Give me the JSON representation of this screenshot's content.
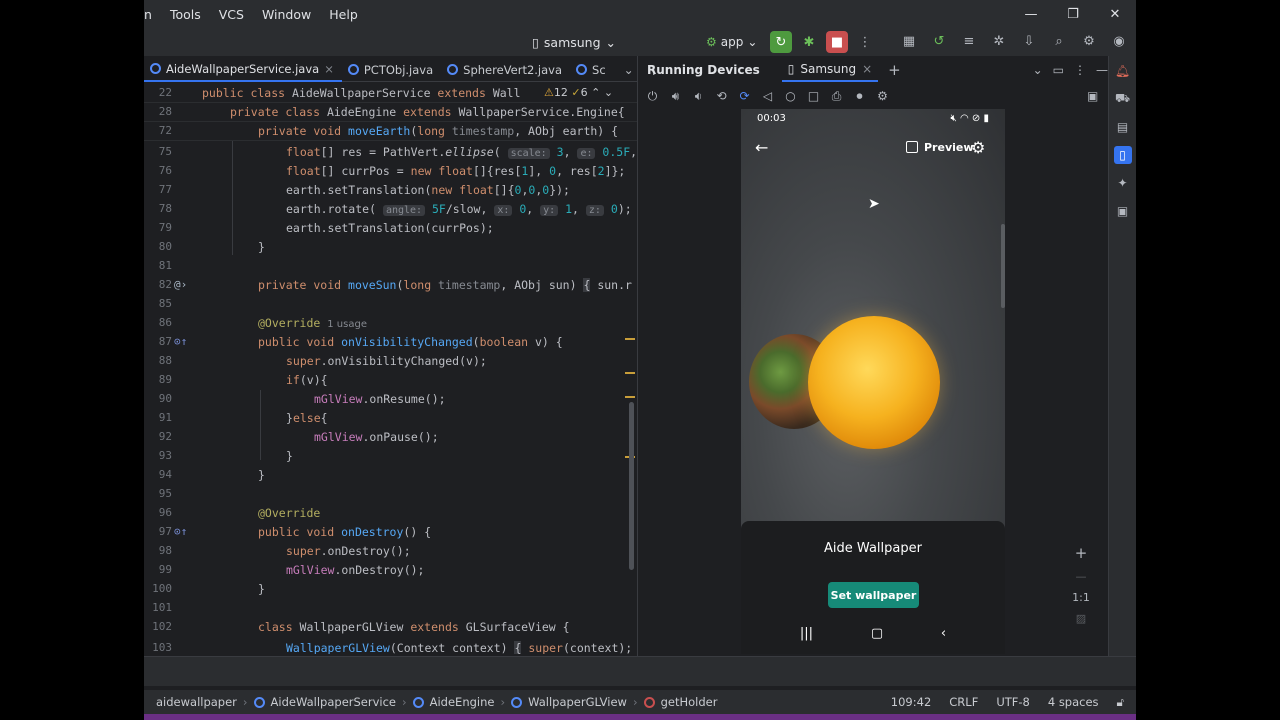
{
  "menu": [
    "n",
    "Tools",
    "VCS",
    "Window",
    "Help"
  ],
  "window_controls": [
    "—",
    "❐",
    "✕"
  ],
  "toolbar": {
    "device": "samsung",
    "config": "app",
    "icons": [
      "run-refresh",
      "debug",
      "stop",
      "more"
    ]
  },
  "editor_tabs": [
    {
      "label": "AideWallpaperService.java",
      "active": true
    },
    {
      "label": "PCTObj.java",
      "active": false
    },
    {
      "label": "SphereVert2.java",
      "active": false
    },
    {
      "label": "Sc",
      "active": false
    }
  ],
  "inspection": {
    "warnings": "12",
    "weak": "6"
  },
  "code_lines": [
    {
      "n": "22"
    },
    {
      "n": "28"
    },
    {
      "n": "72"
    },
    {
      "n": "75"
    },
    {
      "n": "76"
    },
    {
      "n": "77"
    },
    {
      "n": "78"
    },
    {
      "n": "79"
    },
    {
      "n": "80"
    },
    {
      "n": "81"
    },
    {
      "n": "82"
    },
    {
      "n": "85"
    },
    {
      "n": "86"
    },
    {
      "n": "87"
    },
    {
      "n": "88"
    },
    {
      "n": "89"
    },
    {
      "n": "90"
    },
    {
      "n": "91"
    },
    {
      "n": "92"
    },
    {
      "n": "93"
    },
    {
      "n": "94"
    },
    {
      "n": "95"
    },
    {
      "n": "96"
    },
    {
      "n": "97"
    },
    {
      "n": "98"
    },
    {
      "n": "99"
    },
    {
      "n": "100"
    },
    {
      "n": "101"
    },
    {
      "n": "102"
    },
    {
      "n": "103"
    }
  ],
  "code": {
    "usage_hint": "1 usage",
    "hint_scale": "scale:",
    "hint_e": "e:",
    "hint_angle": "angle:",
    "hint_x": "x:",
    "hint_y": "y:",
    "hint_z": "z:"
  },
  "running_devices": {
    "title": "Running Devices",
    "device_tab": "Samsung"
  },
  "phone": {
    "time": "00:03",
    "preview_label": "Preview",
    "wallpaper_name": "Aide Wallpaper",
    "set_button": "Set wallpaper"
  },
  "zoom": {
    "ratio": "1:1"
  },
  "breadcrumbs": [
    "aidewallpaper",
    "AideWallpaperService",
    "AideEngine",
    "WallpaperGLView",
    "getHolder"
  ],
  "status": {
    "position": "109:42",
    "line_sep": "CRLF",
    "encoding": "UTF-8",
    "indent": "4 spaces"
  },
  "colors": {
    "accent": "#3574f0",
    "run_green": "#4e9a3f",
    "stop_red": "#c94f4f",
    "set_button": "#168a78"
  }
}
